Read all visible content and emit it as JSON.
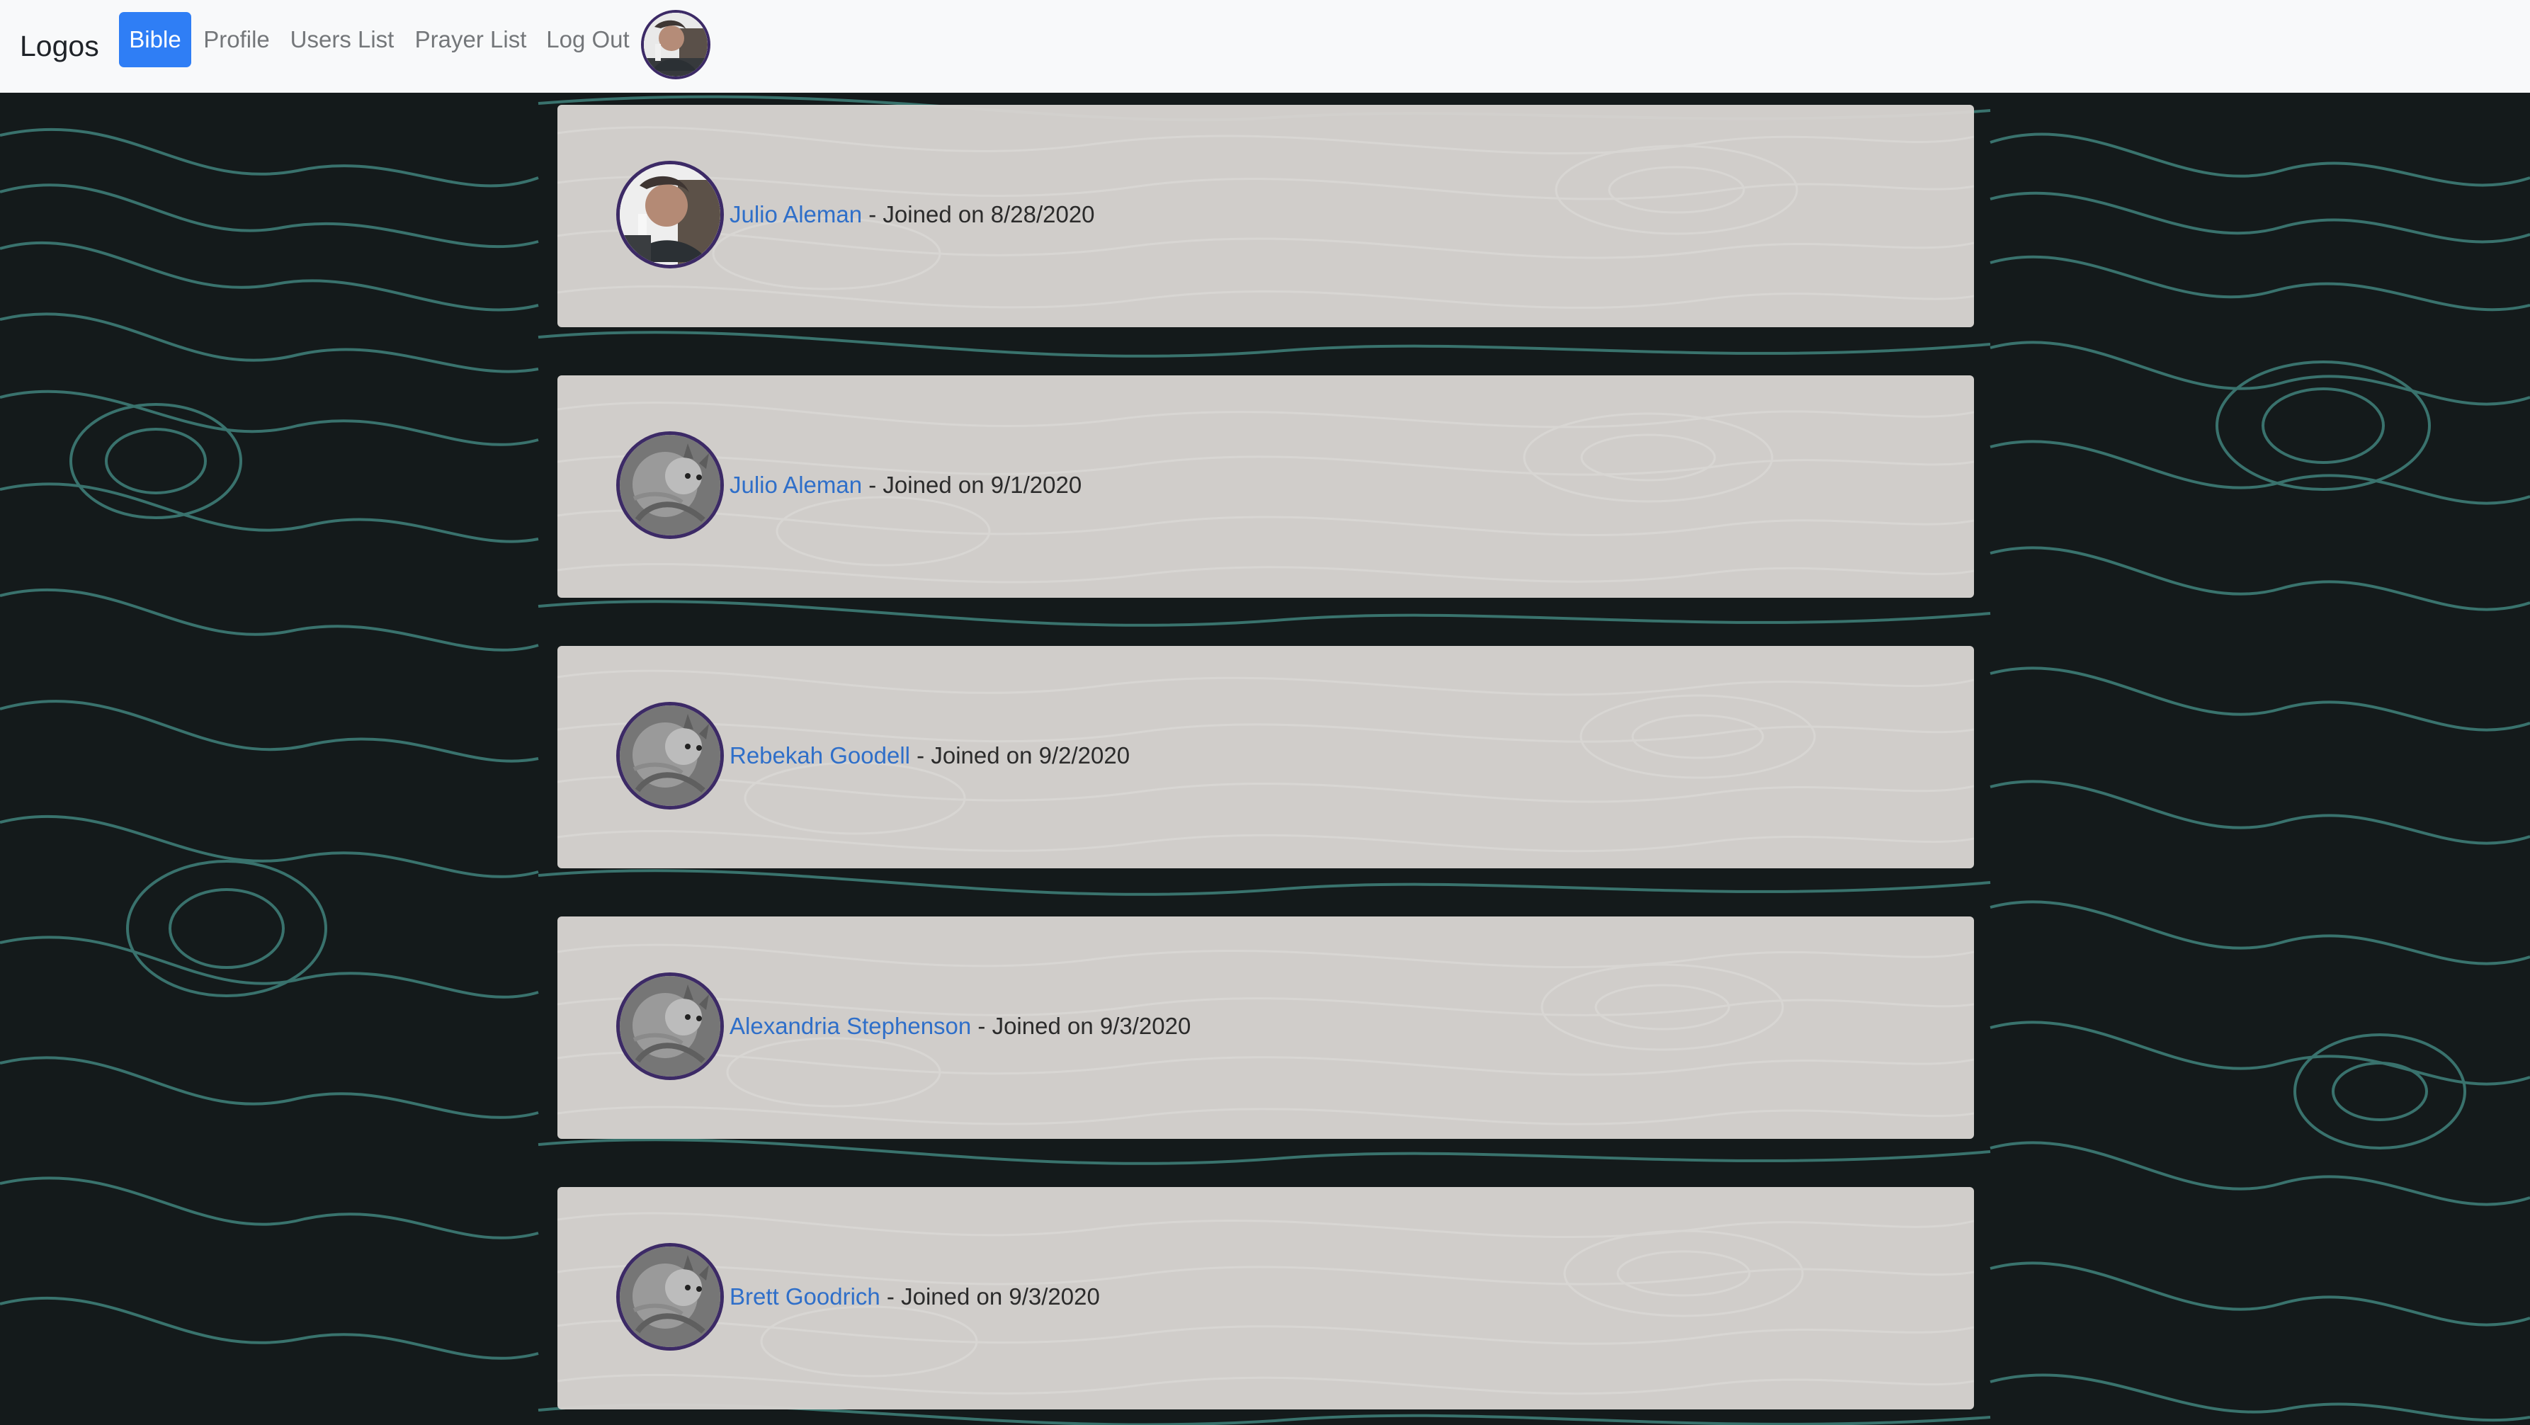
{
  "app": {
    "brand": "Logos"
  },
  "nav": {
    "items": [
      {
        "label": "Bible",
        "active": true
      },
      {
        "label": "Profile",
        "active": false
      },
      {
        "label": "Users List",
        "active": false
      },
      {
        "label": "Prayer List",
        "active": false
      },
      {
        "label": "Log Out",
        "active": false
      }
    ],
    "avatar_icon": "user-avatar-icon"
  },
  "users": [
    {
      "name": "Julio Aleman",
      "joined_text": " - Joined on 8/28/2020",
      "avatar_icon": "person-photo-avatar-icon"
    },
    {
      "name": "Julio Aleman",
      "joined_text": " - Joined on 9/1/2020",
      "avatar_icon": "cat-photo-avatar-icon"
    },
    {
      "name": "Rebekah Goodell",
      "joined_text": " - Joined on 9/2/2020",
      "avatar_icon": "cat-photo-avatar-icon"
    },
    {
      "name": "Alexandria Stephenson",
      "joined_text": " - Joined on 9/3/2020",
      "avatar_icon": "cat-photo-avatar-icon"
    },
    {
      "name": "Brett Goodrich",
      "joined_text": " - Joined on 9/3/2020",
      "avatar_icon": "cat-photo-avatar-icon"
    }
  ],
  "colors": {
    "navbar_bg": "#f8f9fa",
    "active_nav": "#2f7ef5",
    "link": "#2f6fc9",
    "card_bg": "#d8d3d0",
    "page_bg": "#141a1b",
    "contour": "#3f7f79",
    "avatar_border": "#3c2a66"
  }
}
